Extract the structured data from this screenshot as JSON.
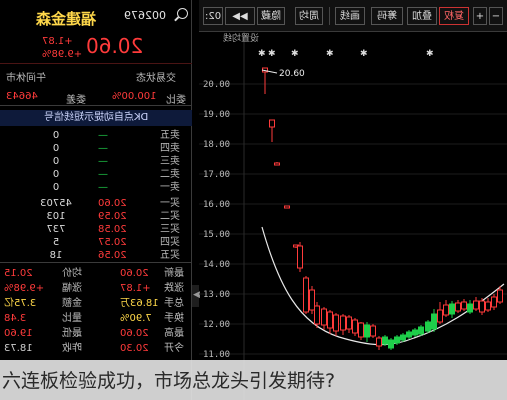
{
  "header": {
    "stock_name": "福建金森",
    "stock_code": "002679",
    "search_icon": "search-icon"
  },
  "quote": {
    "last_price": "20.60",
    "change_abs": "+1.87",
    "change_pct": "+9.98%"
  },
  "status": {
    "trade_status": "交易状态",
    "market_state": "午间休市"
  },
  "ratio": {
    "weibi_label": "委比",
    "weibi_value": "100.00%",
    "weicha_label": "委差",
    "weicha_value": "46643"
  },
  "signal_bar": "DK点自动提示短线信号",
  "order_book": {
    "sell": [
      {
        "label": "卖五",
        "flag": "—",
        "vol": "0"
      },
      {
        "label": "卖四",
        "flag": "—",
        "vol": "0"
      },
      {
        "label": "卖三",
        "flag": "—",
        "vol": "0"
      },
      {
        "label": "卖二",
        "flag": "—",
        "vol": "0"
      },
      {
        "label": "卖一",
        "flag": "—",
        "vol": "0"
      }
    ],
    "buy": [
      {
        "label": "买一",
        "price": "20.60",
        "vol": "45703"
      },
      {
        "label": "买二",
        "price": "20.59",
        "vol": "103"
      },
      {
        "label": "买三",
        "price": "20.58",
        "vol": "737"
      },
      {
        "label": "买四",
        "price": "20.57",
        "vol": "5"
      },
      {
        "label": "买五",
        "price": "20.56",
        "vol": "18"
      }
    ]
  },
  "stats": [
    {
      "l1": "最新",
      "v1": "20.60",
      "l2": "均价",
      "v2": "20.15"
    },
    {
      "l1": "涨跌",
      "v1": "+1.87",
      "l2": "涨幅",
      "v2": "+9.98%"
    },
    {
      "l1": "总手",
      "v1": "18.63万",
      "l2": "金额",
      "v2": "3.75亿"
    },
    {
      "l1": "换手",
      "v1": "7.90%",
      "l2": "量比",
      "v2": "3.48"
    },
    {
      "l1": "最高",
      "v1": "20.60",
      "l2": "最低",
      "v2": "19.60"
    },
    {
      "l1": "今开",
      "v1": "20.30",
      "l2": "昨收",
      "v2": "18.73"
    }
  ],
  "toolbar": {
    "btn1": "02:",
    "btn2": "◀◀",
    "btn3": "隐藏",
    "btn4": "周均",
    "btn5": "画线",
    "btn6": "筹码",
    "btn7": "叠加",
    "btn8": "复权",
    "btn9": "+",
    "btn10": "−"
  },
  "chart": {
    "legend_text": "设置均线",
    "price_tag": "20.60",
    "star_glyph": "✱",
    "y_ticks": [
      "20.00",
      "19.00",
      "18.00",
      "17.00",
      "16.00",
      "15.00",
      "14.00",
      "13.00",
      "12.00",
      "11.00"
    ]
  },
  "chart_data": {
    "type": "candlestick",
    "y_axis_ticks": [
      20.0,
      19.0,
      18.0,
      17.0,
      16.0,
      15.0,
      14.0,
      13.0,
      12.0,
      11.0
    ],
    "annotations": [
      "20.60"
    ],
    "colors": {
      "up": "#ff3b3b",
      "down": "#1ecf4a",
      "ma": "#e8e8e8"
    }
  },
  "caption": "六连板检验成功，市场总龙头引发期待?"
}
